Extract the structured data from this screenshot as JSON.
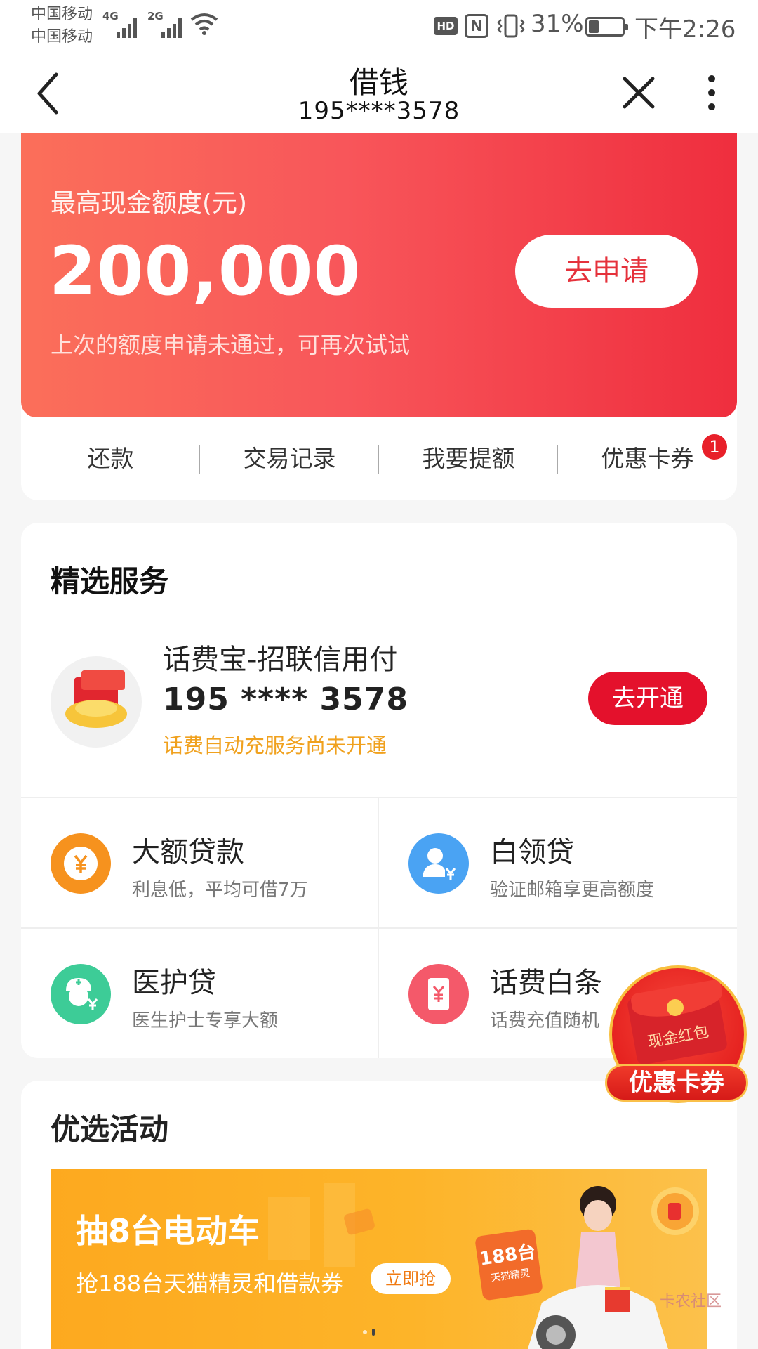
{
  "status_bar": {
    "carrier1": "中国移动",
    "carrier2": "中国移动",
    "network1": "4G",
    "network2": "2G",
    "battery_pct": "31%",
    "battery_level": 0.31,
    "time": "下午2:26",
    "hd_label": "HD",
    "nfc_label": "N"
  },
  "nav": {
    "title": "借钱",
    "subtitle": "195****3578"
  },
  "hero": {
    "label": "最高现金额度(元)",
    "amount": "200,000",
    "note": "上次的额度申请未通过，可再次试试",
    "apply_button": "去申请",
    "colors": {
      "start": "#fb6f5a",
      "end": "#ef2e3e"
    }
  },
  "quick_actions": [
    {
      "label": "还款"
    },
    {
      "label": "交易记录"
    },
    {
      "label": "我要提额"
    },
    {
      "label": "优惠卡券",
      "badge": "1"
    }
  ],
  "services": {
    "title": "精选服务",
    "featured": {
      "name": "话费宝-招联信用付",
      "phone": "195 **** 3578",
      "note": "话费自动充服务尚未开通",
      "button": "去开通",
      "icon": "gold-ingot-icon"
    },
    "grid": [
      {
        "name": "大额贷款",
        "desc": "利息低，平均可借7万",
        "icon": "yuan-coin-icon",
        "color": "#f6921e"
      },
      {
        "name": "白领贷",
        "desc": "验证邮箱享更高额度",
        "icon": "person-yuan-icon",
        "color": "#4aa3f3"
      },
      {
        "name": "医护贷",
        "desc": "医生护士专享大额",
        "icon": "nurse-icon",
        "color": "#3dcc97"
      },
      {
        "name": "话费白条",
        "desc": "话费充值随机",
        "icon": "phone-bill-icon",
        "color": "#f4596a"
      }
    ]
  },
  "activities": {
    "title": "优选活动",
    "banner": {
      "headline": "抽8台电动车",
      "sub": "抢188台天猫精灵和借款券",
      "button": "立即抢",
      "tag_main": "188台",
      "tag_sub": "天猫精灵"
    }
  },
  "floating": {
    "envelope_text": "现金红包",
    "label": "优惠卡券"
  },
  "watermark": "卡农社区"
}
